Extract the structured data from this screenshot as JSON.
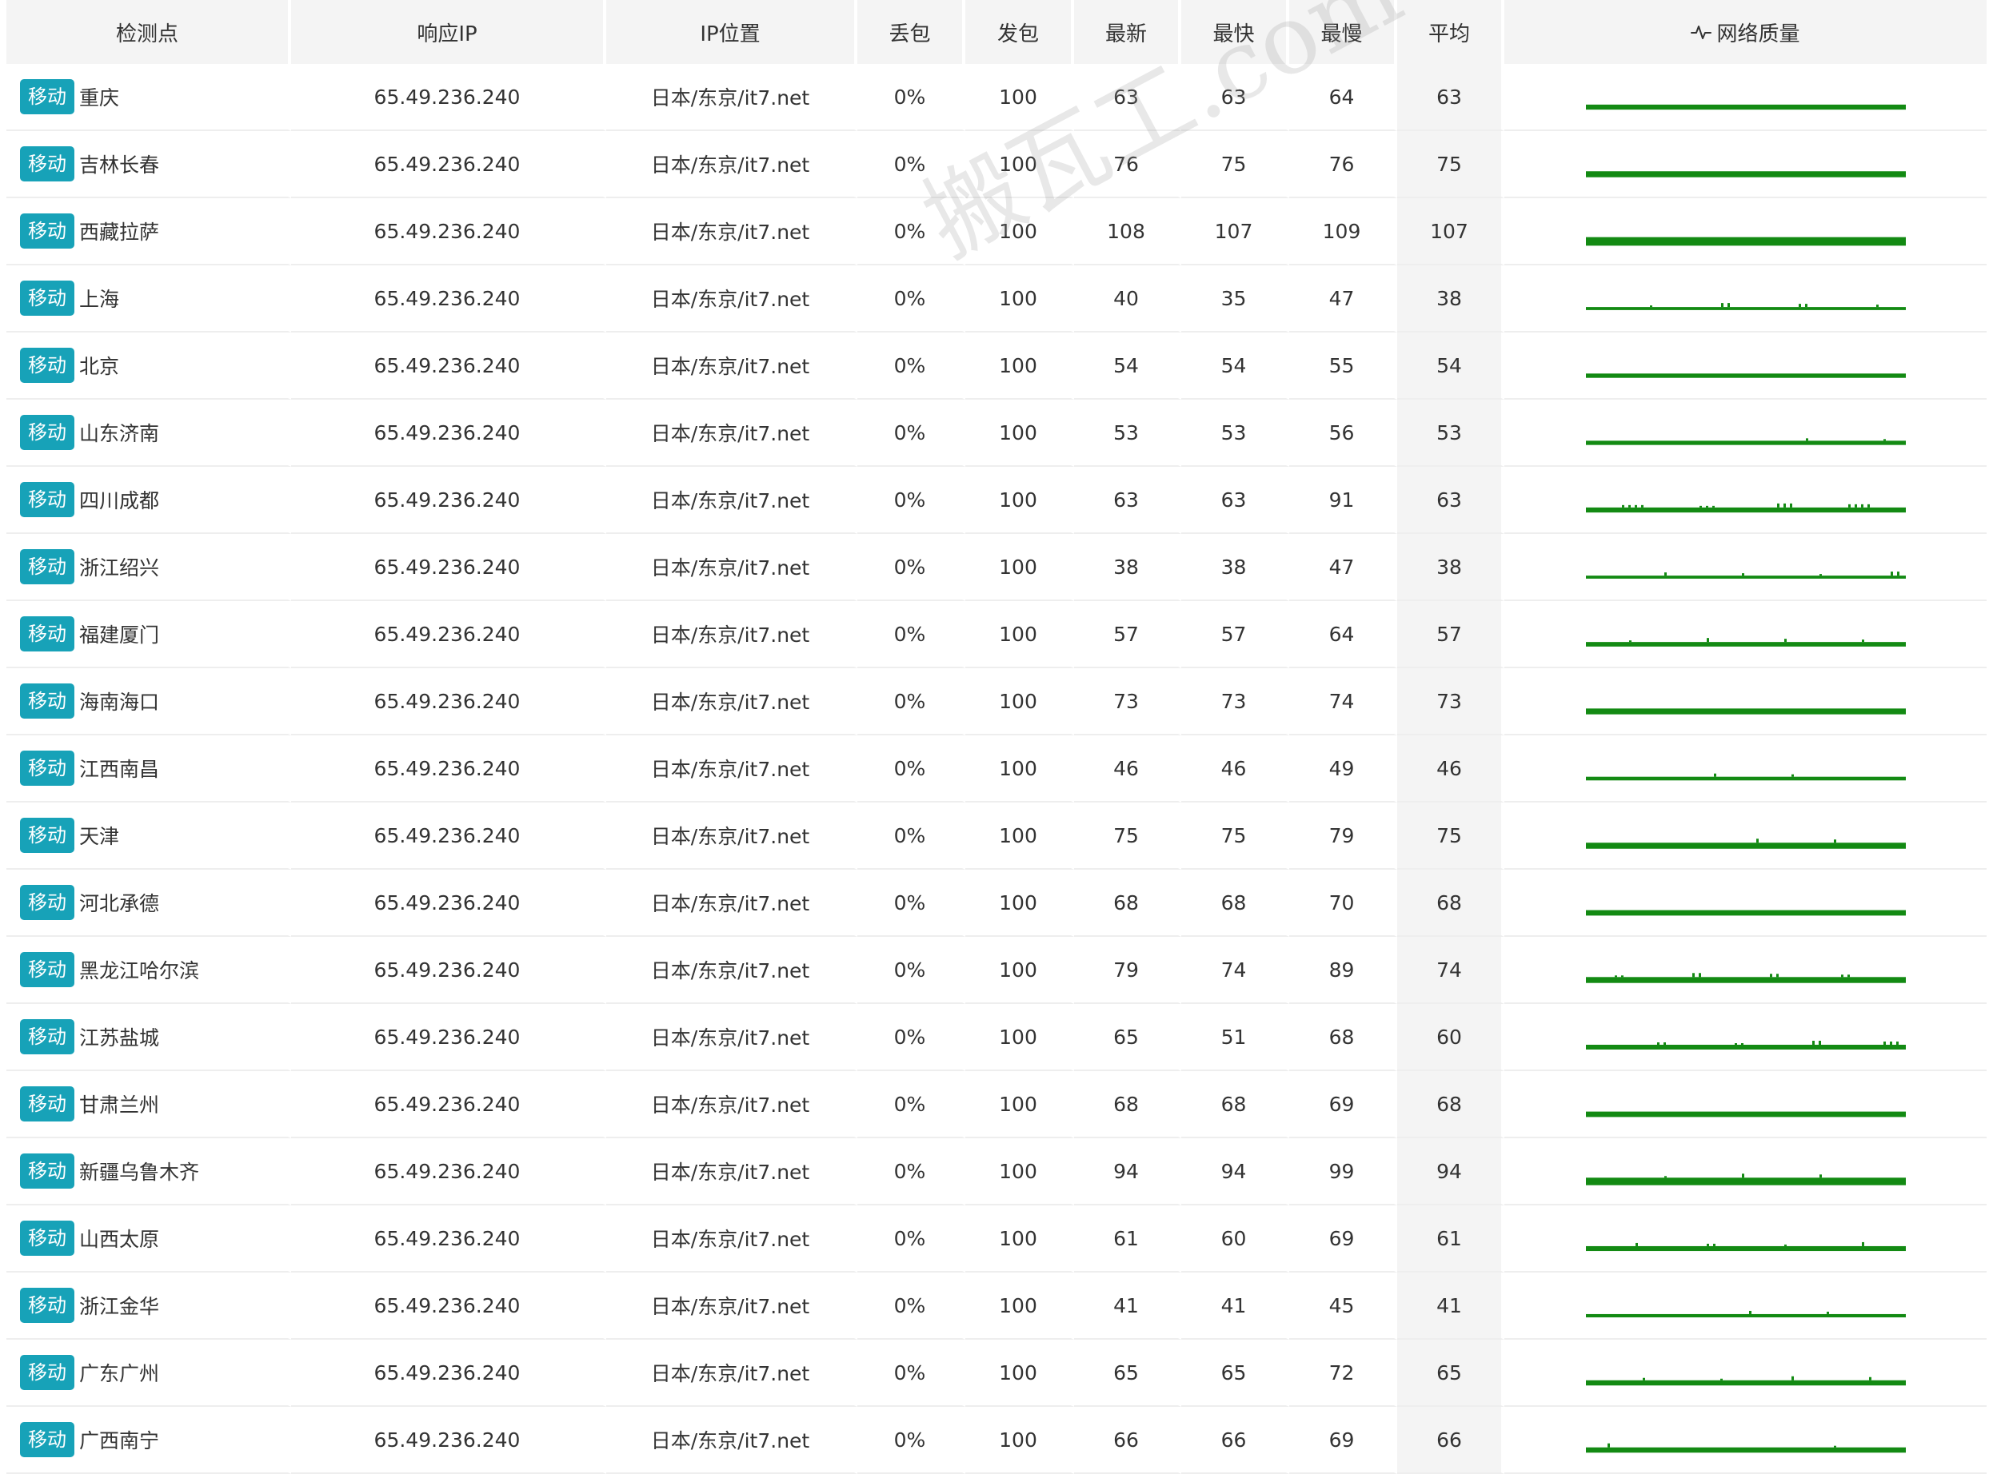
{
  "columns": {
    "node": "检测点",
    "ip": "响应IP",
    "location": "IP位置",
    "loss": "丢包",
    "sent": "发包",
    "latest": "最新",
    "fastest": "最快",
    "slowest": "最慢",
    "average": "平均",
    "quality": "网络质量"
  },
  "quality_icon": "pulse-icon",
  "isp_badge_color": "#17a2b8",
  "spark_color": "#138a13",
  "watermark": "搬瓦工.com",
  "rows": [
    {
      "isp": "移动",
      "node": "重庆",
      "ip": "65.49.236.240",
      "location": "日本/东京/it7.net",
      "loss": "0%",
      "sent": "100",
      "latest": "63",
      "fastest": "63",
      "slowest": "64",
      "average": "63"
    },
    {
      "isp": "移动",
      "node": "吉林长春",
      "ip": "65.49.236.240",
      "location": "日本/东京/it7.net",
      "loss": "0%",
      "sent": "100",
      "latest": "76",
      "fastest": "75",
      "slowest": "76",
      "average": "75"
    },
    {
      "isp": "移动",
      "node": "西藏拉萨",
      "ip": "65.49.236.240",
      "location": "日本/东京/it7.net",
      "loss": "0%",
      "sent": "100",
      "latest": "108",
      "fastest": "107",
      "slowest": "109",
      "average": "107"
    },
    {
      "isp": "移动",
      "node": "上海",
      "ip": "65.49.236.240",
      "location": "日本/东京/it7.net",
      "loss": "0%",
      "sent": "100",
      "latest": "40",
      "fastest": "35",
      "slowest": "47",
      "average": "38"
    },
    {
      "isp": "移动",
      "node": "北京",
      "ip": "65.49.236.240",
      "location": "日本/东京/it7.net",
      "loss": "0%",
      "sent": "100",
      "latest": "54",
      "fastest": "54",
      "slowest": "55",
      "average": "54"
    },
    {
      "isp": "移动",
      "node": "山东济南",
      "ip": "65.49.236.240",
      "location": "日本/东京/it7.net",
      "loss": "0%",
      "sent": "100",
      "latest": "53",
      "fastest": "53",
      "slowest": "56",
      "average": "53"
    },
    {
      "isp": "移动",
      "node": "四川成都",
      "ip": "65.49.236.240",
      "location": "日本/东京/it7.net",
      "loss": "0%",
      "sent": "100",
      "latest": "63",
      "fastest": "63",
      "slowest": "91",
      "average": "63"
    },
    {
      "isp": "移动",
      "node": "浙江绍兴",
      "ip": "65.49.236.240",
      "location": "日本/东京/it7.net",
      "loss": "0%",
      "sent": "100",
      "latest": "38",
      "fastest": "38",
      "slowest": "47",
      "average": "38"
    },
    {
      "isp": "移动",
      "node": "福建厦门",
      "ip": "65.49.236.240",
      "location": "日本/东京/it7.net",
      "loss": "0%",
      "sent": "100",
      "latest": "57",
      "fastest": "57",
      "slowest": "64",
      "average": "57"
    },
    {
      "isp": "移动",
      "node": "海南海口",
      "ip": "65.49.236.240",
      "location": "日本/东京/it7.net",
      "loss": "0%",
      "sent": "100",
      "latest": "73",
      "fastest": "73",
      "slowest": "74",
      "average": "73"
    },
    {
      "isp": "移动",
      "node": "江西南昌",
      "ip": "65.49.236.240",
      "location": "日本/东京/it7.net",
      "loss": "0%",
      "sent": "100",
      "latest": "46",
      "fastest": "46",
      "slowest": "49",
      "average": "46"
    },
    {
      "isp": "移动",
      "node": "天津",
      "ip": "65.49.236.240",
      "location": "日本/东京/it7.net",
      "loss": "0%",
      "sent": "100",
      "latest": "75",
      "fastest": "75",
      "slowest": "79",
      "average": "75"
    },
    {
      "isp": "移动",
      "node": "河北承德",
      "ip": "65.49.236.240",
      "location": "日本/东京/it7.net",
      "loss": "0%",
      "sent": "100",
      "latest": "68",
      "fastest": "68",
      "slowest": "70",
      "average": "68"
    },
    {
      "isp": "移动",
      "node": "黑龙江哈尔滨",
      "ip": "65.49.236.240",
      "location": "日本/东京/it7.net",
      "loss": "0%",
      "sent": "100",
      "latest": "79",
      "fastest": "74",
      "slowest": "89",
      "average": "74"
    },
    {
      "isp": "移动",
      "node": "江苏盐城",
      "ip": "65.49.236.240",
      "location": "日本/东京/it7.net",
      "loss": "0%",
      "sent": "100",
      "latest": "65",
      "fastest": "51",
      "slowest": "68",
      "average": "60"
    },
    {
      "isp": "移动",
      "node": "甘肃兰州",
      "ip": "65.49.236.240",
      "location": "日本/东京/it7.net",
      "loss": "0%",
      "sent": "100",
      "latest": "68",
      "fastest": "68",
      "slowest": "69",
      "average": "68"
    },
    {
      "isp": "移动",
      "node": "新疆乌鲁木齐",
      "ip": "65.49.236.240",
      "location": "日本/东京/it7.net",
      "loss": "0%",
      "sent": "100",
      "latest": "94",
      "fastest": "94",
      "slowest": "99",
      "average": "94"
    },
    {
      "isp": "移动",
      "node": "山西太原",
      "ip": "65.49.236.240",
      "location": "日本/东京/it7.net",
      "loss": "0%",
      "sent": "100",
      "latest": "61",
      "fastest": "60",
      "slowest": "69",
      "average": "61"
    },
    {
      "isp": "移动",
      "node": "浙江金华",
      "ip": "65.49.236.240",
      "location": "日本/东京/it7.net",
      "loss": "0%",
      "sent": "100",
      "latest": "41",
      "fastest": "41",
      "slowest": "45",
      "average": "41"
    },
    {
      "isp": "移动",
      "node": "广东广州",
      "ip": "65.49.236.240",
      "location": "日本/东京/it7.net",
      "loss": "0%",
      "sent": "100",
      "latest": "65",
      "fastest": "65",
      "slowest": "72",
      "average": "65"
    },
    {
      "isp": "移动",
      "node": "广西南宁",
      "ip": "65.49.236.240",
      "location": "日本/东京/it7.net",
      "loss": "0%",
      "sent": "100",
      "latest": "66",
      "fastest": "66",
      "slowest": "69",
      "average": "66"
    }
  ]
}
